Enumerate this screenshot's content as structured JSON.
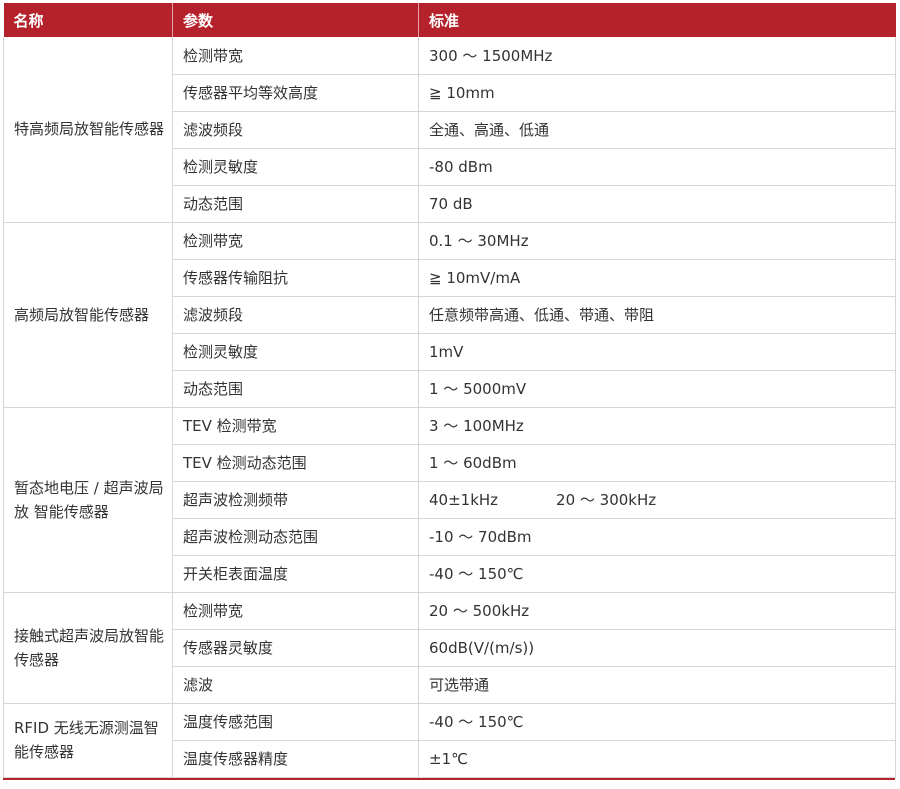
{
  "header": {
    "col_name": "名称",
    "col_param": "参数",
    "col_std": "标准"
  },
  "groups": [
    {
      "name": "特高频局放智能传感器",
      "rows": [
        {
          "param": "检测带宽",
          "std": "300 ～ 1500MHz"
        },
        {
          "param": "传感器平均等效高度",
          "std": "≧ 10mm"
        },
        {
          "param": "滤波频段",
          "std": "全通、高通、低通"
        },
        {
          "param": "检测灵敏度",
          "std": "-80 dBm"
        },
        {
          "param": "动态范围",
          "std": "70 dB"
        }
      ]
    },
    {
      "name": "高频局放智能传感器",
      "rows": [
        {
          "param": "检测带宽",
          "std": "0.1 ～ 30MHz"
        },
        {
          "param": "传感器传输阻抗",
          "std": "≧ 10mV/mA"
        },
        {
          "param": "滤波频段",
          "std": "任意频带高通、低通、带通、带阻"
        },
        {
          "param": "检测灵敏度",
          "std": "1mV"
        },
        {
          "param": "动态范围",
          "std": "1 ～ 5000mV"
        }
      ]
    },
    {
      "name": "暂态地电压 / 超声波局放 智能传感器",
      "rows": [
        {
          "param": "TEV 检测带宽",
          "std": "3 ～ 100MHz"
        },
        {
          "param": "TEV 检测动态范围",
          "std": "1 ～ 60dBm"
        },
        {
          "param": "超声波检测频带",
          "std": "40±1kHz",
          "std2": "20 ～ 300kHz"
        },
        {
          "param": "超声波检测动态范围",
          "std": "-10 ～ 70dBm"
        },
        {
          "param": "开关柜表面温度",
          "std": "-40 ～ 150℃"
        }
      ]
    },
    {
      "name": "接触式超声波局放智能传感器",
      "rows": [
        {
          "param": "检测带宽",
          "std": "20 ～ 500kHz"
        },
        {
          "param": "传感器灵敏度",
          "std": "60dB(V/(m/s))"
        },
        {
          "param": "滤波",
          "std": "可选带通"
        }
      ]
    },
    {
      "name": "RFID 无线无源测温智能传感器",
      "rows": [
        {
          "param": "温度传感范围",
          "std": "-40 ～ 150℃"
        },
        {
          "param": "温度传感器精度",
          "std": "±1℃"
        }
      ]
    }
  ],
  "colors": {
    "header_bg": "#b5222b",
    "header_text": "#ffffff",
    "border": "#d6d6d6",
    "text": "#333333"
  }
}
